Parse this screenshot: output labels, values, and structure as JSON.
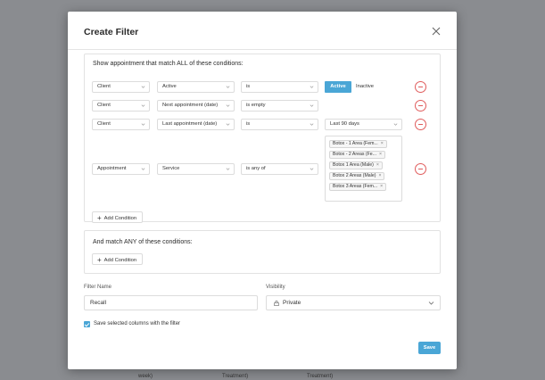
{
  "background": {
    "texts": [
      "week)",
      "Treatment)",
      "Treatment)"
    ]
  },
  "modal": {
    "title": "Create Filter",
    "close_icon": "close-icon"
  },
  "all_conditions": {
    "title": "Show appointment that match ALL of these conditions:",
    "rows": [
      {
        "field": "Client",
        "attribute": "Active",
        "operator": "is",
        "toggle": {
          "on": "Active",
          "off": "Inactive",
          "selected": "Active"
        }
      },
      {
        "field": "Client",
        "attribute": "Next appointment (date)",
        "operator": "is empty"
      },
      {
        "field": "Client",
        "attribute": "Last appointment (date)",
        "operator": "is",
        "value": "Last 90 days"
      },
      {
        "field": "Appointment",
        "attribute": "Service",
        "operator": "is any of",
        "tags": [
          "Botox - 1 Area (Fem...",
          "Botox - 2 Areas (Fe...",
          "Botox 1 Area (Male)",
          "Botox 2 Areas (Male)",
          "Botox 3 Areas (Fem..."
        ]
      }
    ],
    "add_condition": "Add Condition"
  },
  "any_conditions": {
    "title": "And match ANY of these conditions:",
    "add_condition": "Add Condition"
  },
  "filter_name": {
    "label": "Filter Name",
    "value": "Recall"
  },
  "visibility": {
    "label": "Visibility",
    "value": "Private",
    "icon": "lock-icon"
  },
  "save_columns": {
    "checked": true,
    "label": "Save selected columns with the filter"
  },
  "save_label": "Save",
  "colors": {
    "accent": "#4aa6d6",
    "remove": "#e05d5d"
  }
}
